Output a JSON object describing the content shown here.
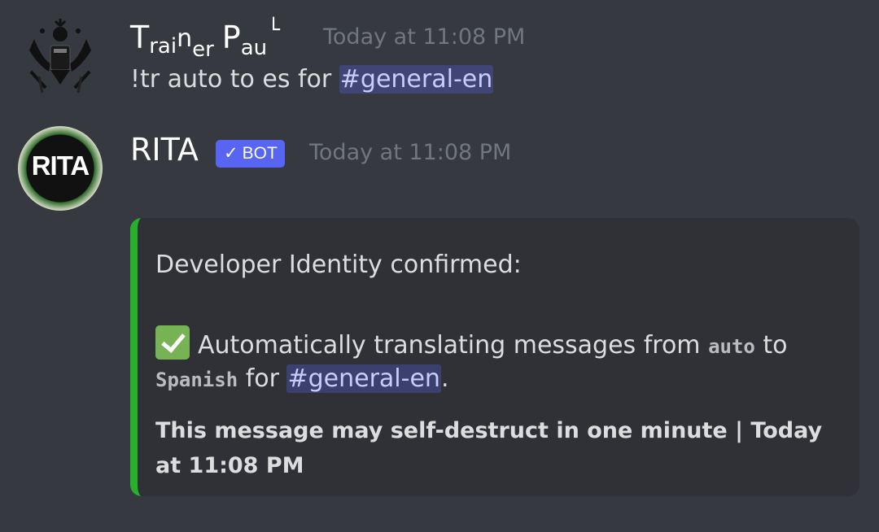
{
  "messages": [
    {
      "author": "Trainer Paul",
      "author_display": {
        "T": "T",
        "ra": "ra",
        "i": "i",
        "n": "n",
        "er": "er",
        "P": "P",
        "au": "au",
        "l": "└"
      },
      "timestamp": "Today at 11:08 PM",
      "text_prefix": "!tr auto to es for ",
      "channel_mention": "#general-en"
    },
    {
      "author": "RITA",
      "avatar_label": "RITA",
      "badge": "BOT",
      "badge_icon": "✓",
      "timestamp": "Today at 11:08 PM",
      "embed": {
        "accent_color": "#27b02b",
        "line1": "Developer Identity confirmed:",
        "line2_text_a": "Automatically translating messages from ",
        "line2_code_a": "auto",
        "line2_text_b": " to",
        "line3_code": "Spanish",
        "line3_text": " for ",
        "line3_mention": "#general-en",
        "line3_end": ".",
        "footer": "This message may self-destruct in one minute | Today at 11:08 PM"
      }
    }
  ],
  "colors": {
    "background": "#36393f",
    "embed_bg": "#2f3136",
    "mention_text": "#c9cdfb",
    "bot_badge": "#5865f2",
    "timestamp": "#72767d"
  }
}
